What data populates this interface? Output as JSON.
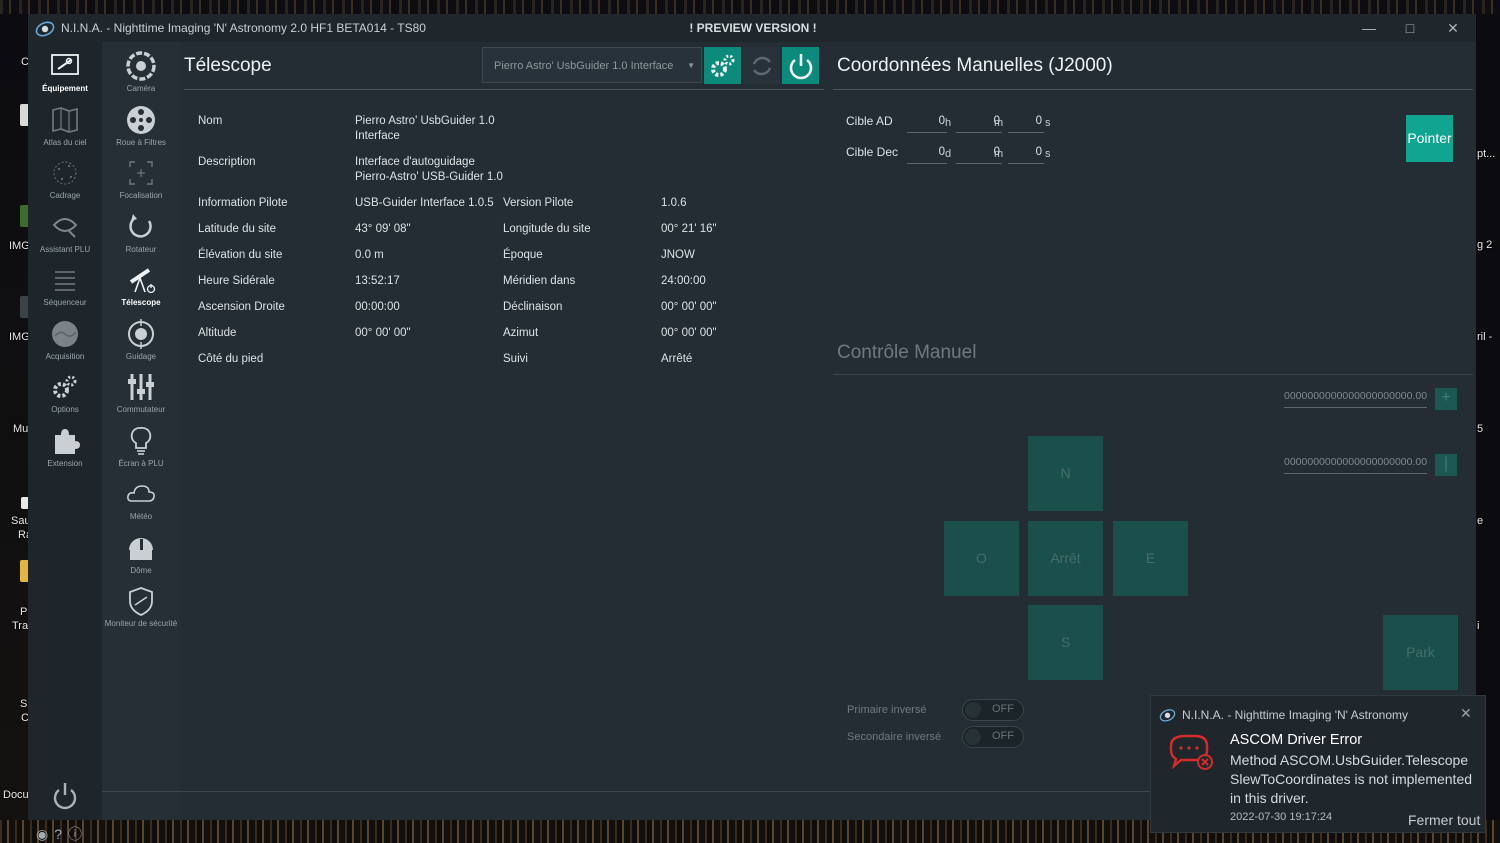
{
  "window": {
    "title": "N.I.N.A. - Nighttime Imaging 'N' Astronomy 2.0 HF1 BETA014  -  TS80",
    "preview": "! PREVIEW VERSION !",
    "minimize": "—",
    "maximize": "□",
    "close": "✕"
  },
  "desktop": {
    "labels": [
      "C",
      "IMG",
      "IMG",
      "Mu",
      "Sau",
      "Ra",
      "P",
      "Tra",
      "Sl",
      "C",
      "Docu"
    ],
    "right_labels": [
      "pt...",
      "g 2",
      "ril -",
      "5",
      "e",
      "i"
    ]
  },
  "sidebar_primary": [
    {
      "label": "Équipement",
      "icon": "equipment-icon",
      "active": true
    },
    {
      "label": "Atlas du ciel",
      "icon": "sky-atlas-icon"
    },
    {
      "label": "Cadrage",
      "icon": "framing-icon"
    },
    {
      "label": "Assistant PLU",
      "icon": "flat-wizard-icon"
    },
    {
      "label": "Séquenceur",
      "icon": "sequencer-icon"
    },
    {
      "label": "Acquisition",
      "icon": "imaging-icon"
    },
    {
      "label": "Options",
      "icon": "options-icon"
    },
    {
      "label": "Extension",
      "icon": "plugin-icon"
    }
  ],
  "sidebar_secondary": [
    {
      "label": "Caméra",
      "icon": "camera-icon"
    },
    {
      "label": "Roue à Filtres",
      "icon": "filter-wheel-icon"
    },
    {
      "label": "Focalisation",
      "icon": "focuser-icon"
    },
    {
      "label": "Rotateur",
      "icon": "rotator-icon"
    },
    {
      "label": "Télescope",
      "icon": "telescope-icon",
      "active": true
    },
    {
      "label": "Guidage",
      "icon": "guider-icon"
    },
    {
      "label": "Commutateur",
      "icon": "switch-icon"
    },
    {
      "label": "Écran à PLU",
      "icon": "flat-panel-icon"
    },
    {
      "label": "Météo",
      "icon": "weather-icon"
    },
    {
      "label": "Dôme",
      "icon": "dome-icon"
    },
    {
      "label": "Moniteur de sécurité",
      "icon": "safety-monitor-icon"
    }
  ],
  "telescope": {
    "title": "Télescope",
    "device": "Pierro Astro' UsbGuider 1.0 Interface",
    "rows": [
      {
        "label": "Nom",
        "value": "Pierro Astro' UsbGuider 1.0\nInterface"
      },
      {
        "label": "Description",
        "value": "Interface d'autoguidage\nPierro-Astro' USB-Guider 1.0"
      }
    ],
    "pairs": [
      {
        "l1": "Information Pilote",
        "v1": "USB-Guider Interface 1.0.5",
        "l2": "Version Pilote",
        "v2": "1.0.6"
      },
      {
        "l1": "Latitude du site",
        "v1": "43° 09' 08\"",
        "l2": "Longitude du site",
        "v2": "00° 21' 16\""
      },
      {
        "l1": "Élévation du site",
        "v1": "0.0 m",
        "l2": "Époque",
        "v2": "JNOW"
      },
      {
        "l1": "Heure Sidérale",
        "v1": "13:52:17",
        "l2": "Méridien dans",
        "v2": "24:00:00"
      },
      {
        "l1": "Ascension Droite",
        "v1": "00:00:00",
        "l2": "Déclinaison",
        "v2": "00° 00' 00\""
      },
      {
        "l1": "Altitude",
        "v1": "00° 00' 00\"",
        "l2": "Azimut",
        "v2": "00° 00' 00\""
      },
      {
        "l1": "Côté du pied",
        "v1": "",
        "l2": "Suivi",
        "v2": "Arrêté"
      }
    ]
  },
  "coordinates": {
    "title": "Coordonnées Manuelles (J2000)",
    "ra_label": "Cible AD",
    "dec_label": "Cible Dec",
    "ra": [
      {
        "value": "0",
        "unit": "h"
      },
      {
        "value": "0",
        "unit": "m"
      },
      {
        "value": "0",
        "unit": "s"
      }
    ],
    "dec": [
      {
        "value": "0",
        "unit": "d"
      },
      {
        "value": "0",
        "unit": "m"
      },
      {
        "value": "0",
        "unit": "s"
      }
    ],
    "slew_label": "Pointer"
  },
  "manual_control": {
    "title": "Contrôle Manuel",
    "rate1": "0000000000000000000000.00",
    "rate2": "0000000000000000000000.00",
    "north": "N",
    "west": "O",
    "stop": "Arrêt",
    "east": "E",
    "south": "S",
    "park": "Park",
    "primary_reversed": "Primaire inversé",
    "secondary_reversed": "Secondaire inversé",
    "toggle_off": "OFF"
  },
  "toast": {
    "app": "N.I.N.A. - Nighttime Imaging 'N' Astronomy",
    "title": "ASCOM Driver Error",
    "body": "Method ASCOM.UsbGuider.Telescope SlewToCoordinates is not implemented in this driver.",
    "time": "2022-07-30 19:17:24",
    "clear_all": "Fermer tout",
    "close": "✕"
  },
  "footer_icons": [
    "◉",
    "?",
    "ⓘ"
  ],
  "colors": {
    "accent": "#0c8a7c",
    "pointer": "#0fa590",
    "dir_button": "#1a4f4c",
    "window_bg": "#232d33",
    "error": "#d42b2b"
  }
}
